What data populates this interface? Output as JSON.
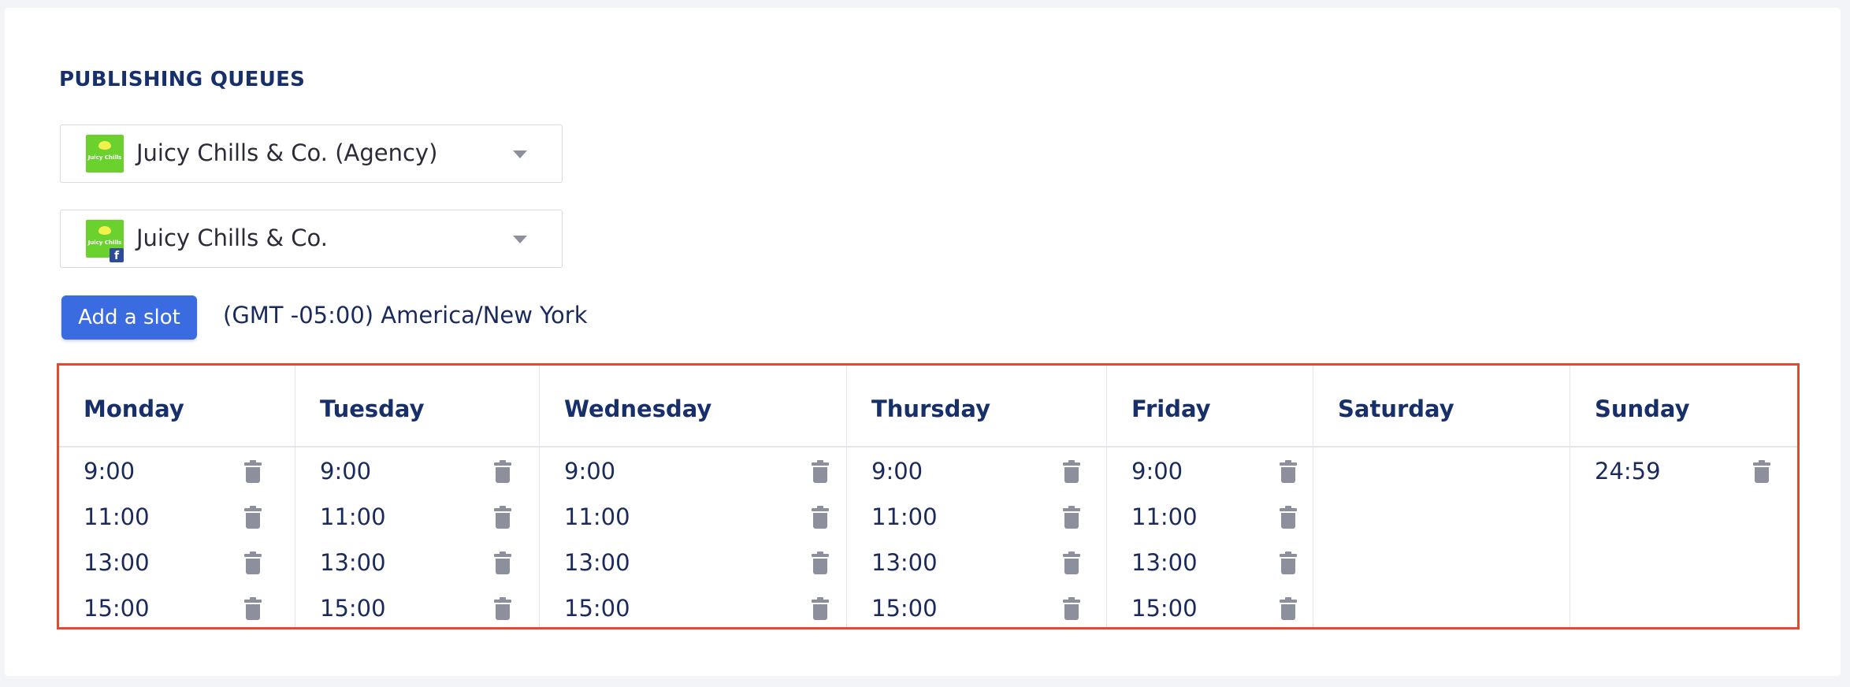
{
  "page": {
    "title": "PUBLISHING QUEUES"
  },
  "selects": [
    {
      "label": "Juicy Chills & Co. (Agency)",
      "logo_text": "Juicy Chills"
    },
    {
      "label": "Juicy Chills & Co.",
      "logo_text": "Juicy Chills",
      "network_badge": "f"
    }
  ],
  "actions": {
    "add_slot_label": "Add a slot"
  },
  "timezone": "(GMT -05:00) America/New York",
  "days": [
    {
      "name": "Monday",
      "slots": [
        "9:00",
        "11:00",
        "13:00",
        "15:00"
      ]
    },
    {
      "name": "Tuesday",
      "slots": [
        "9:00",
        "11:00",
        "13:00",
        "15:00"
      ]
    },
    {
      "name": "Wednesday",
      "slots": [
        "9:00",
        "11:00",
        "13:00",
        "15:00"
      ]
    },
    {
      "name": "Thursday",
      "slots": [
        "9:00",
        "11:00",
        "13:00",
        "15:00"
      ]
    },
    {
      "name": "Friday",
      "slots": [
        "9:00",
        "11:00",
        "13:00",
        "15:00"
      ]
    },
    {
      "name": "Saturday",
      "slots": []
    },
    {
      "name": "Sunday",
      "slots": [
        "24:59"
      ]
    }
  ],
  "icons": {
    "delete": "trash-icon",
    "dropdown": "caret-down-icon"
  },
  "colors": {
    "accent": "#3a6be0",
    "highlight_border": "#e04a2f",
    "text": "#1b2a5c",
    "brand_logo": "#6ad12f"
  }
}
